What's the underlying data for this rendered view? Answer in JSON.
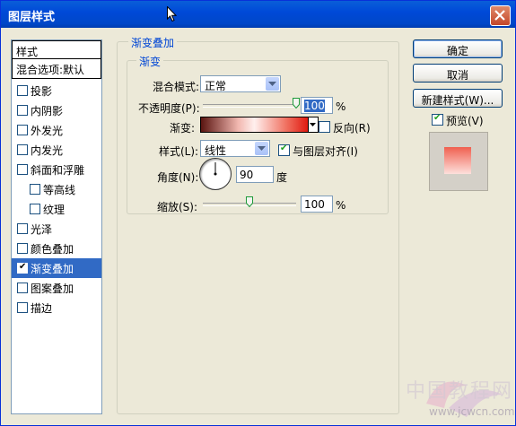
{
  "window": {
    "title": "图层样式"
  },
  "sidebar": {
    "header": "样式",
    "blend_options": "混合选项:默认",
    "items": [
      {
        "label": "投影",
        "checked": false
      },
      {
        "label": "内阴影",
        "checked": false
      },
      {
        "label": "外发光",
        "checked": false
      },
      {
        "label": "内发光",
        "checked": false
      },
      {
        "label": "斜面和浮雕",
        "checked": false
      },
      {
        "label": "等高线",
        "checked": false
      },
      {
        "label": "纹理",
        "checked": false
      },
      {
        "label": "光泽",
        "checked": false
      },
      {
        "label": "颜色叠加",
        "checked": false
      },
      {
        "label": "渐变叠加",
        "checked": true
      },
      {
        "label": "图案叠加",
        "checked": false
      },
      {
        "label": "描边",
        "checked": false
      }
    ]
  },
  "panel": {
    "title": "渐变叠加",
    "section": "渐变",
    "blend_mode_label": "混合模式:",
    "blend_mode_value": "正常",
    "opacity_label": "不透明度(P):",
    "opacity_value": "100",
    "opacity_level": 1.0,
    "percent": "%",
    "gradient_label": "渐变:",
    "reverse_label": "反向(R)",
    "reverse_checked": false,
    "style_label": "样式(L):",
    "style_value": "线性",
    "align_label": "与图层对齐(I)",
    "align_checked": true,
    "angle_label": "角度(N):",
    "angle_value": "90",
    "angle_unit": "度",
    "scale_label": "缩放(S):",
    "scale_value": "100",
    "scale_level": 0.5
  },
  "buttons": {
    "ok": "确定",
    "cancel": "取消",
    "new_style": "新建样式(W)...",
    "preview_label": "预览(V)",
    "preview_checked": true
  },
  "watermark": {
    "text": "中国教程网",
    "url": "www.jcwcn.com"
  },
  "colors": {
    "titlebar": "#0049d8",
    "selection": "#316ac5",
    "legend": "#0046d5",
    "dialog_bg": "#ece9d8"
  }
}
